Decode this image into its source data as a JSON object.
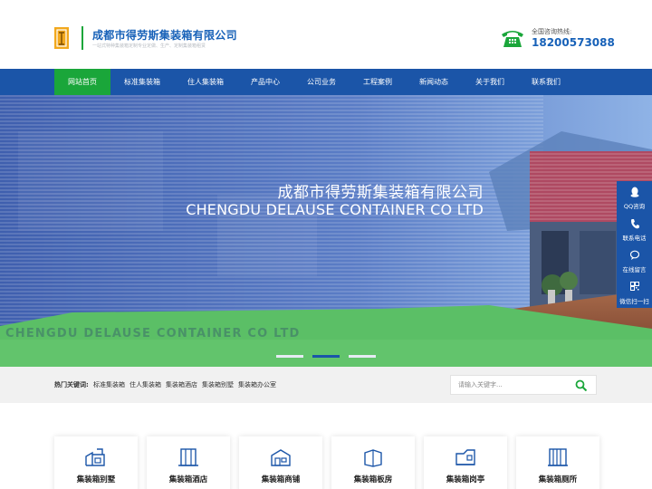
{
  "header": {
    "company_name": "成都市得劳斯集装箱有限公司",
    "slogan": "一站式特种集装箱定制专业定做、生产、定制集装箱租赁",
    "hotline_label": "全国咨询热线:",
    "hotline_number": "18200573088"
  },
  "nav": {
    "items": [
      {
        "label": "网站首页",
        "active": true
      },
      {
        "label": "标准集装箱",
        "active": false
      },
      {
        "label": "住人集装箱",
        "active": false
      },
      {
        "label": "产品中心",
        "active": false
      },
      {
        "label": "公司业务",
        "active": false
      },
      {
        "label": "工程案例",
        "active": false
      },
      {
        "label": "新闻动态",
        "active": false
      },
      {
        "label": "关于我们",
        "active": false
      },
      {
        "label": "联系我们",
        "active": false
      }
    ]
  },
  "banner": {
    "title": "成都市得劳斯集装箱有限公司",
    "subtitle": "CHENGDU DELAUSE CONTAINER CO LTD",
    "ghost_text": "CHENGDU DELAUSE CONTAINER CO LTD",
    "slide_count": 3,
    "active_slide": 2
  },
  "side_float": {
    "items": [
      {
        "label": "QQ咨询",
        "icon": "qq-icon"
      },
      {
        "label": "联系电话",
        "icon": "phone-icon"
      },
      {
        "label": "在线留言",
        "icon": "message-icon"
      },
      {
        "label": "微信扫一扫",
        "icon": "qrcode-icon"
      }
    ]
  },
  "keywords": {
    "label": "热门关键词:",
    "items": [
      "标准集装箱",
      "住人集装箱",
      "集装箱酒店",
      "集装箱别墅",
      "集装箱办公室"
    ]
  },
  "search": {
    "placeholder": "请输入关键字..."
  },
  "products": {
    "items": [
      {
        "label": "集装箱别墅",
        "icon": "villa-icon"
      },
      {
        "label": "集装箱酒店",
        "icon": "hotel-icon"
      },
      {
        "label": "集装箱商铺",
        "icon": "shop-icon"
      },
      {
        "label": "集装箱板房",
        "icon": "board-house-icon"
      },
      {
        "label": "集装箱岗亭",
        "icon": "sentry-box-icon"
      },
      {
        "label": "集装箱厕所",
        "icon": "toilet-icon"
      }
    ]
  },
  "colors": {
    "brand_blue": "#1b55a8",
    "accent_green": "#1aa63a",
    "logo_orange": "#f2a81d"
  }
}
